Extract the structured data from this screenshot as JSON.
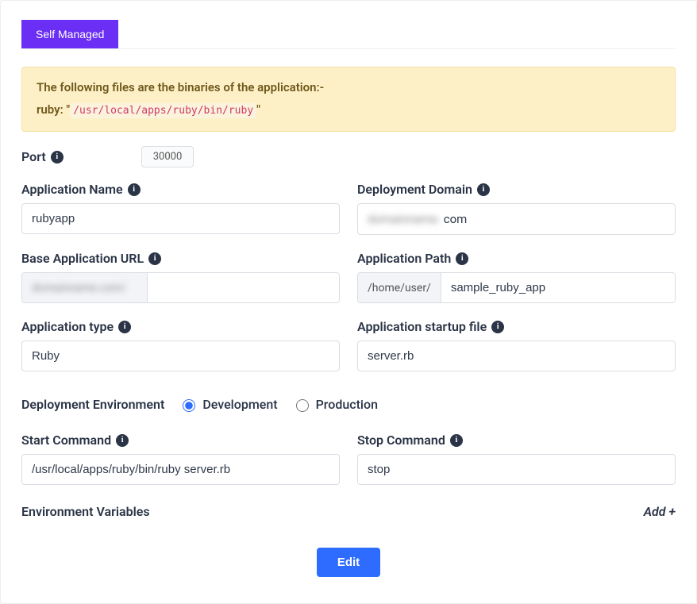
{
  "tab": {
    "label": "Self Managed"
  },
  "notice": {
    "line1": "The following files are the binaries of the application:-",
    "binary_prefix": "ruby:",
    "binary_path": "/usr/local/apps/ruby/bin/ruby"
  },
  "port": {
    "label": "Port",
    "value": "30000"
  },
  "fields": {
    "app_name": {
      "label": "Application Name",
      "value": "rubyapp"
    },
    "deploy_domain": {
      "label": "Deployment Domain",
      "value": "com",
      "hidden_prefix": "domainname."
    },
    "base_url": {
      "label": "Base Application URL",
      "prefix": "domainname.com/",
      "value": ""
    },
    "app_path": {
      "label": "Application Path",
      "prefix": "/home/user/",
      "value": "sample_ruby_app"
    },
    "app_type": {
      "label": "Application type",
      "value": "Ruby"
    },
    "startup_file": {
      "label": "Application startup file",
      "value": "server.rb"
    },
    "start_cmd": {
      "label": "Start Command",
      "value": "/usr/local/apps/ruby/bin/ruby server.rb"
    },
    "stop_cmd": {
      "label": "Stop Command",
      "value": "stop"
    }
  },
  "deploy_env": {
    "label": "Deployment Environment",
    "options": {
      "dev": "Development",
      "prod": "Production"
    },
    "selected": "dev"
  },
  "env_vars": {
    "label": "Environment Variables",
    "add_label": "Add +"
  },
  "buttons": {
    "edit": "Edit"
  }
}
